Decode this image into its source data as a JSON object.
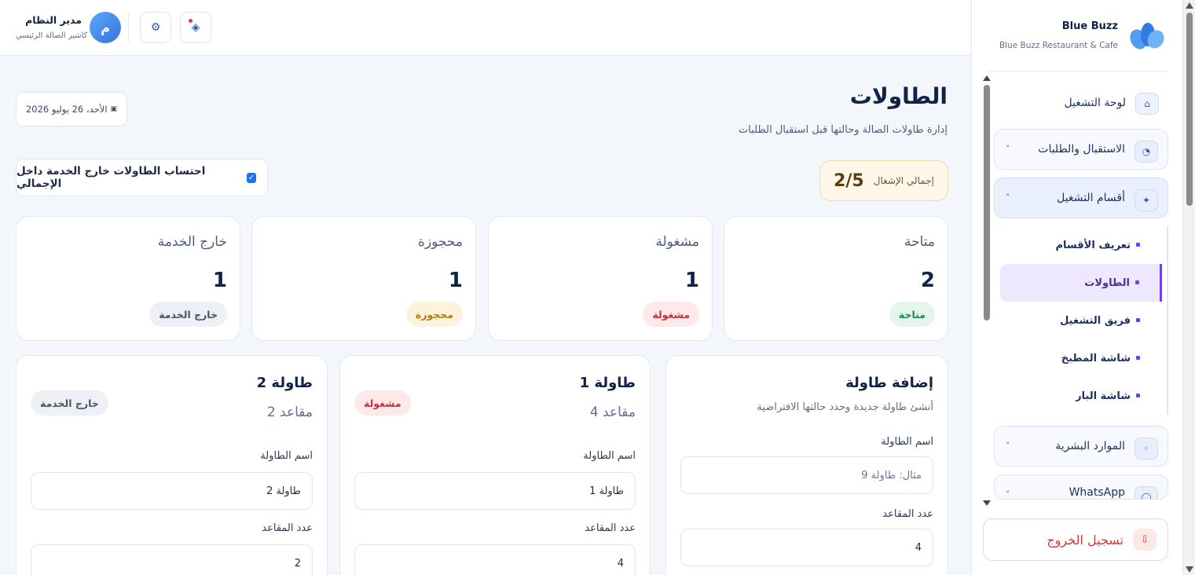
{
  "brand": {
    "name": "Blue Buzz",
    "subtitle": "Blue Buzz Restaurant & Cafe"
  },
  "header": {
    "user_name": "مدير النظام",
    "user_role": "كاشير الصالة الرئيسي",
    "avatar_initial": "م"
  },
  "sidebar": {
    "items": [
      {
        "label": "لوحة التشغيل",
        "icon": "home-icon"
      },
      {
        "label": "الاستقبال والطلبات",
        "icon": "pie-chart-icon"
      },
      {
        "label": "أقسام التشغيل",
        "icon": "sparkle-icon"
      }
    ],
    "subitems": [
      {
        "label": "تعريف الأقسام"
      },
      {
        "label": "الطاولات",
        "active": true
      },
      {
        "label": "فريق التشغيل"
      },
      {
        "label": "شاشة المطبخ"
      },
      {
        "label": "شاشة البار"
      }
    ],
    "more_items": [
      {
        "label": "الموارد البشرية",
        "icon": "dot-icon"
      },
      {
        "label": "WhatsApp",
        "icon": "circle-icon"
      }
    ],
    "logout_label": "تسجيل الخروج"
  },
  "page": {
    "title": "الطاولات",
    "subtitle": "إدارة طاولات الصالة وحالتها قبل استقبال الطلبات",
    "date": "الأحد، 26 يوليو 2026",
    "occupancy_label": "إجمالي الإشغال",
    "occupancy_value": "2/5",
    "include_out_of_service_label": "احتساب الطاولات خارج الخدمة داخل الإجمالي",
    "include_out_of_service_checked": true
  },
  "stats": [
    {
      "label": "متاحة",
      "value": "2",
      "badge": "متاحة",
      "color": "#1f8a4c"
    },
    {
      "label": "مشغولة",
      "value": "1",
      "badge": "مشغولة",
      "color": "#c62f3e"
    },
    {
      "label": "محجوزة",
      "value": "1",
      "badge": "محجوزة",
      "color": "#b07a12"
    },
    {
      "label": "خارج الخدمة",
      "value": "1",
      "badge": "خارج الخدمة",
      "color": "#4b5566"
    }
  ],
  "add_table": {
    "title": "إضافة طاولة",
    "subtitle": "أنشئ طاولة جديدة وحدد حالتها الافتراضية",
    "name_label": "اسم الطاولة",
    "name_placeholder": "مثال: طاولة 9",
    "seats_label": "عدد المقاعد",
    "seats_value": "4"
  },
  "tables": [
    {
      "name": "طاولة 1",
      "seats": "4 مقاعد",
      "status": "مشغولة",
      "name_label": "اسم الطاولة",
      "name_value": "طاولة 1",
      "seats_label": "عدد المقاعد",
      "seats_value": "4"
    },
    {
      "name": "طاولة 2",
      "seats": "2 مقاعد",
      "status": "خارج الخدمة",
      "name_label": "اسم الطاولة",
      "name_value": "طاولة 2",
      "seats_label": "عدد المقاعد",
      "seats_value": "2"
    }
  ],
  "colors": {
    "accent": "#2f5bb7",
    "active_nav": "#6d3fe0",
    "danger": "#d33a3a"
  }
}
